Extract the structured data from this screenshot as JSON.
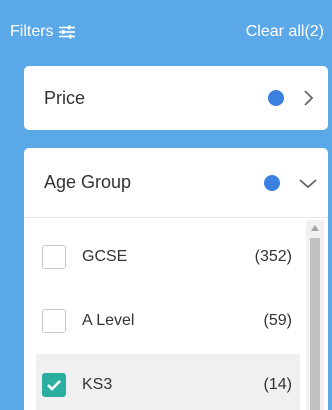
{
  "header": {
    "title": "Filters",
    "clear_label": "Clear all(2)",
    "title_icon": "sliders-icon"
  },
  "price": {
    "label": "Price",
    "indicator_color": "#3b7fe0",
    "chevron": "chevron-right-icon"
  },
  "age_group": {
    "label": "Age Group",
    "indicator_color": "#3b7fe0",
    "chevron": "chevron-down-icon",
    "options": [
      {
        "label": "GCSE",
        "count": "(352)",
        "checked": false
      },
      {
        "label": "A Level",
        "count": "(59)",
        "checked": false
      },
      {
        "label": "KS3",
        "count": "(14)",
        "checked": true
      }
    ]
  },
  "colors": {
    "panel_bg": "#5ba8e8",
    "check_color": "#2aae9f"
  }
}
